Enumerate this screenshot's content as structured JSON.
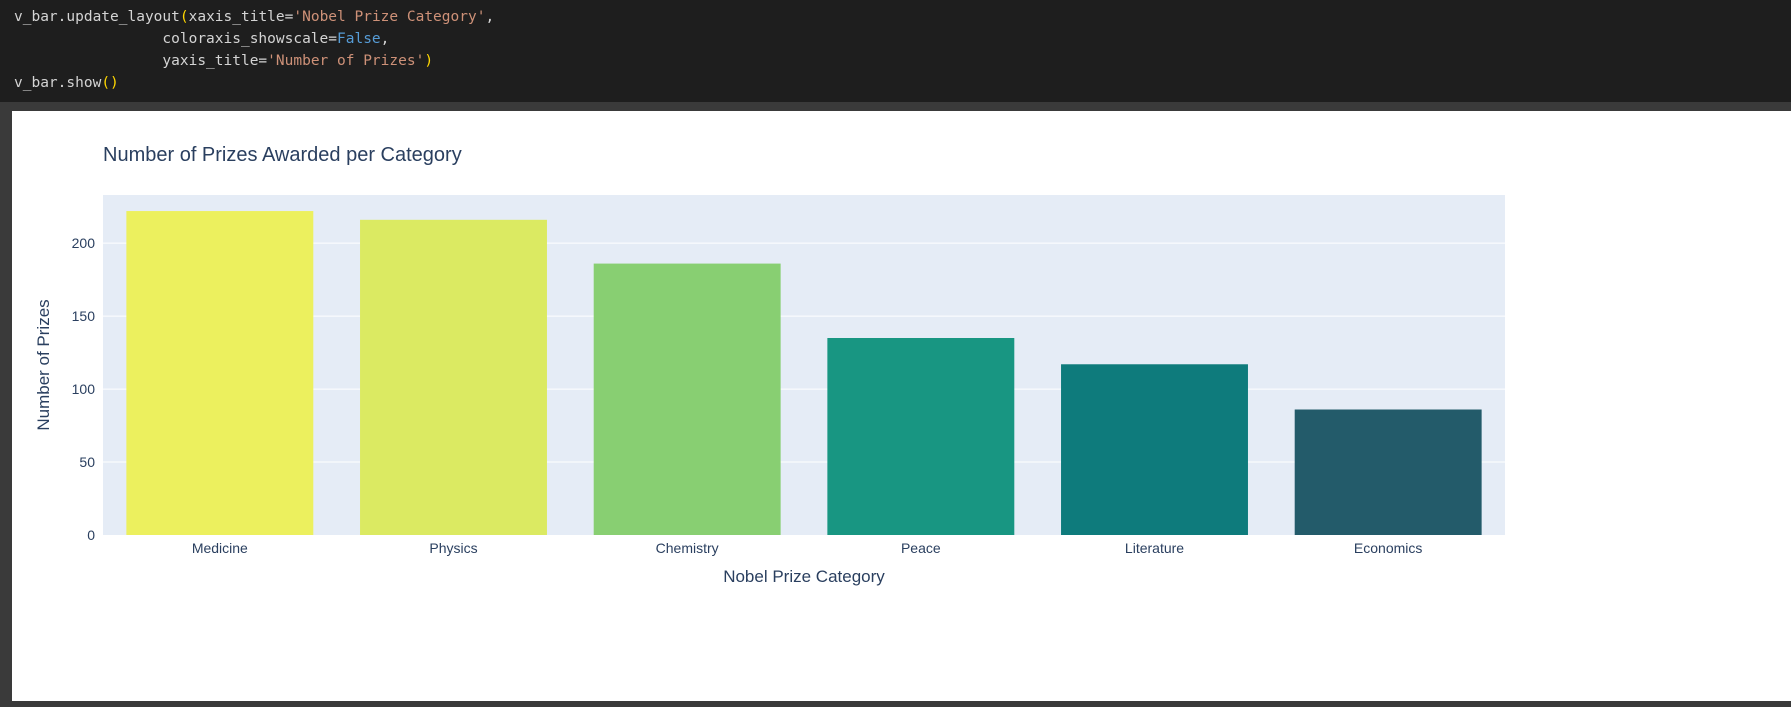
{
  "code": {
    "lines": [
      [
        {
          "t": "v_bar.update_layout",
          "c": ""
        },
        {
          "t": "(",
          "c": "tok-paren"
        },
        {
          "t": "xaxis_title=",
          "c": ""
        },
        {
          "t": "'Nobel Prize Category'",
          "c": "tok-str"
        },
        {
          "t": ",",
          "c": ""
        }
      ],
      [
        {
          "t": "                 coloraxis_showscale=",
          "c": ""
        },
        {
          "t": "False",
          "c": "tok-kw"
        },
        {
          "t": ",",
          "c": ""
        }
      ],
      [
        {
          "t": "                 yaxis_title=",
          "c": ""
        },
        {
          "t": "'Number of Prizes'",
          "c": "tok-str"
        },
        {
          "t": ")",
          "c": "tok-paren"
        }
      ],
      [
        {
          "t": "v_bar.show",
          "c": ""
        },
        {
          "t": "()",
          "c": "tok-paren"
        }
      ]
    ]
  },
  "colors": {
    "plot_bg": "#e5ecf6",
    "grid": "#ffffff",
    "text": "#2a3f5f"
  },
  "chart_data": {
    "type": "bar",
    "title": "Number of Prizes Awarded per Category",
    "xlabel": "Nobel Prize Category",
    "ylabel": "Number of Prizes",
    "categories": [
      "Medicine",
      "Physics",
      "Chemistry",
      "Peace",
      "Literature",
      "Economics"
    ],
    "values": [
      222,
      216,
      186,
      135,
      117,
      86
    ],
    "bar_colors": [
      "#ecf05e",
      "#dbea62",
      "#88cf72",
      "#189682",
      "#0e7b7c",
      "#235b6a"
    ],
    "ylim": [
      0,
      233
    ],
    "yticks": [
      0,
      50,
      100,
      150,
      200
    ],
    "grid": true,
    "legend": false
  }
}
